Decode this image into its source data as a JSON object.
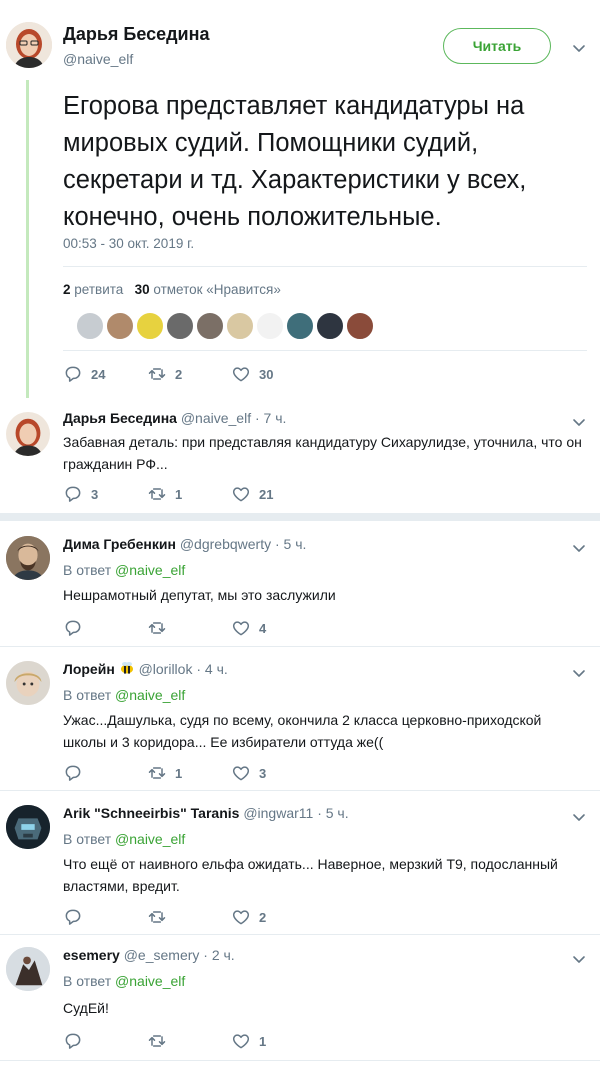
{
  "main_tweet": {
    "author_name": "Дарья Беседина",
    "author_handle": "@naive_elf",
    "follow_label": "Читать",
    "text": "Егорова представляет кандидатуры на мировых судий. Помощники судий, секретари и тд. Характеристики у всех, конечно, очень положительные.",
    "timestamp": "00:53 - 30 окт. 2019 г.",
    "retweets_count": "2",
    "retweets_label": "ретвита",
    "likes_count": "30",
    "likes_label": "отметок «Нравится»",
    "actions": {
      "replies": "24",
      "retweets": "2",
      "likes": "30"
    }
  },
  "replies": [
    {
      "name": "Дарья Беседина",
      "handle": "@naive_elf · 7 ч.",
      "in_reply_prefix": "",
      "in_reply_link": "",
      "text": "Забавная деталь: при представляя кандидатуру Сихарулидзе, уточнила, что он гражданин РФ...",
      "replies": "3",
      "retweets": "1",
      "likes": "21"
    },
    {
      "name": "Дима Гребенкин",
      "handle": "@dgrebqwerty · 5 ч.",
      "in_reply_prefix": "В ответ",
      "in_reply_link": "@naive_elf",
      "text": "Нешрамотный депутат, мы это заслужили",
      "replies": "",
      "retweets": "",
      "likes": "4"
    },
    {
      "name": "Лорейн",
      "handle": "@lorillok · 4 ч.",
      "in_reply_prefix": "В ответ",
      "in_reply_link": "@naive_elf",
      "text": "Ужас...Дашулька, судя по всему, окончила 2 класса церковно-приходской школы и 3 коридора... Ее избиратели оттуда же((",
      "replies": "",
      "retweets": "1",
      "likes": "3"
    },
    {
      "name": "Arik \"Schneeirbis\" Taranis",
      "handle": "@ingwar11 · 5 ч.",
      "in_reply_prefix": "В ответ",
      "in_reply_link": "@naive_elf",
      "text": "Что ещё от наивного ельфа ожидать... Наверное, мерзкий Т9, подосланный властями, вредит.",
      "replies": "",
      "retweets": "",
      "likes": "2"
    },
    {
      "name": "esemery",
      "handle": "@e_semery · 2 ч.",
      "in_reply_prefix": "В ответ",
      "in_reply_link": "@naive_elf",
      "text": "СудЕй!",
      "replies": "",
      "retweets": "",
      "likes": "1"
    }
  ],
  "colors": {
    "accent": "#3aa335",
    "thread_line": "#c4e9bd",
    "muted": "#657786",
    "separator": "#e6ecf0"
  },
  "icons": [
    "reply-icon",
    "retweet-icon",
    "like-icon",
    "chevron-down-icon",
    "bee-emoji-icon"
  ]
}
